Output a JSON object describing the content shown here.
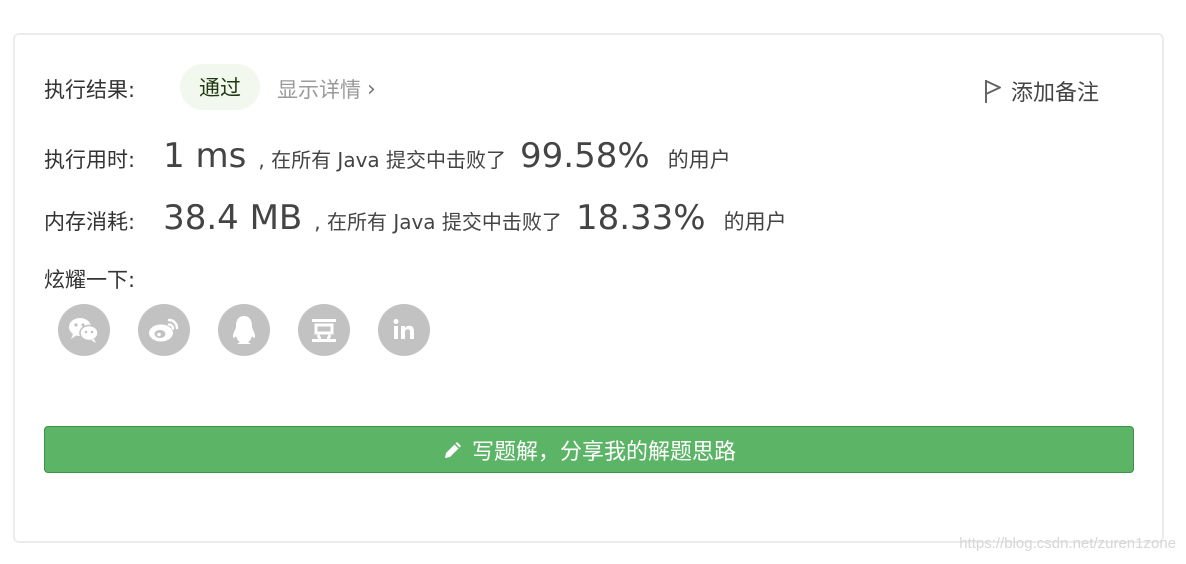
{
  "result": {
    "label": "执行结果:",
    "status": "通过",
    "details_link": "显示详情",
    "add_note": "添加备注"
  },
  "runtime": {
    "label": "执行用时:",
    "value": "1 ms",
    "middle": ", 在所有 Java 提交中击败了",
    "percent": "99.58%",
    "tail": "的用户"
  },
  "memory": {
    "label": "内存消耗:",
    "value": "38.4 MB",
    "middle": ", 在所有 Java 提交中击败了",
    "percent": "18.33%",
    "tail": "的用户"
  },
  "share": {
    "label": "炫耀一下:",
    "icons": [
      "wechat-icon",
      "weibo-icon",
      "qq-icon",
      "douban-icon",
      "linkedin-icon"
    ]
  },
  "solution_button": {
    "label": "写题解，分享我的解题思路"
  },
  "watermark": "https://blog.csdn.net/zuren1zone",
  "colors": {
    "accent_green": "#5cb467",
    "pill_bg": "#f2f8ee",
    "social_gray": "#c2c2c2"
  }
}
